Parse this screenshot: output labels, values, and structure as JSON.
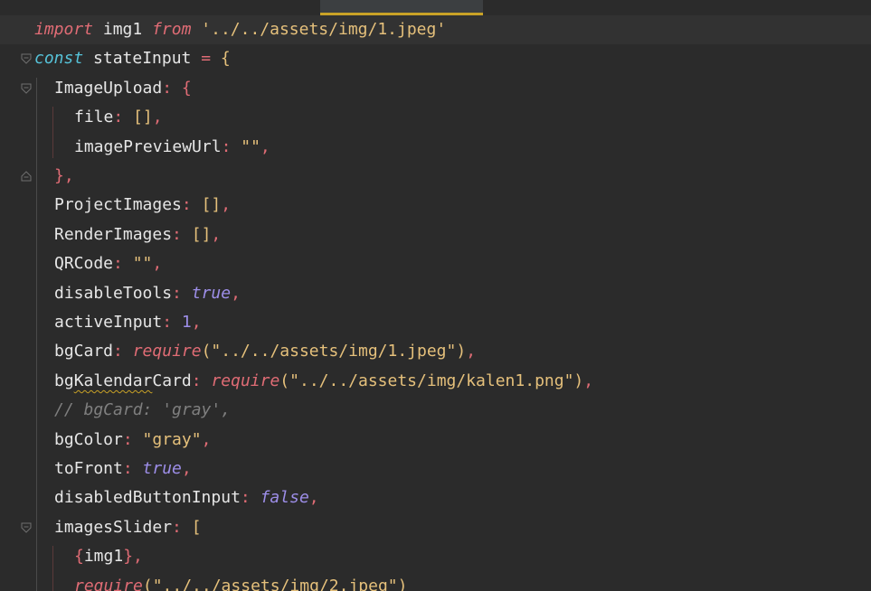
{
  "editor": {
    "lines": [
      [
        {
          "t": "import",
          "c": "kw"
        },
        {
          "t": " img1 ",
          "c": "id"
        },
        {
          "t": "from",
          "c": "kw"
        },
        {
          "t": " ",
          "c": "id"
        },
        {
          "t": "'../../assets/img/1.jpeg'",
          "c": "str"
        }
      ],
      [
        {
          "t": "const",
          "c": "const"
        },
        {
          "t": " stateInput ",
          "c": "id"
        },
        {
          "t": "=",
          "c": "punct"
        },
        {
          "t": " {",
          "c": "brace"
        }
      ],
      [
        {
          "t": "ImageUpload",
          "c": "prop"
        },
        {
          "t": ":",
          "c": "punct"
        },
        {
          "t": " {",
          "c": "punct"
        }
      ],
      [
        {
          "t": "file",
          "c": "prop"
        },
        {
          "t": ":",
          "c": "punct"
        },
        {
          "t": " []",
          "c": "brace"
        },
        {
          "t": ",",
          "c": "comma"
        }
      ],
      [
        {
          "t": "imagePreviewUrl",
          "c": "prop"
        },
        {
          "t": ":",
          "c": "punct"
        },
        {
          "t": " \"\"",
          "c": "str"
        },
        {
          "t": ",",
          "c": "comma"
        }
      ],
      [
        {
          "t": "}",
          "c": "punct"
        },
        {
          "t": ",",
          "c": "comma"
        }
      ],
      [
        {
          "t": "ProjectImages",
          "c": "prop"
        },
        {
          "t": ":",
          "c": "punct"
        },
        {
          "t": " []",
          "c": "brace"
        },
        {
          "t": ",",
          "c": "comma"
        }
      ],
      [
        {
          "t": "RenderImages",
          "c": "prop"
        },
        {
          "t": ":",
          "c": "punct"
        },
        {
          "t": " []",
          "c": "brace"
        },
        {
          "t": ",",
          "c": "comma"
        }
      ],
      [
        {
          "t": "QRCode",
          "c": "prop"
        },
        {
          "t": ":",
          "c": "punct"
        },
        {
          "t": " \"\"",
          "c": "str"
        },
        {
          "t": ",",
          "c": "comma"
        }
      ],
      [
        {
          "t": "disableTools",
          "c": "prop"
        },
        {
          "t": ":",
          "c": "punct"
        },
        {
          "t": " ",
          "c": "id"
        },
        {
          "t": "true",
          "c": "bool"
        },
        {
          "t": ",",
          "c": "comma"
        }
      ],
      [
        {
          "t": "activeInput",
          "c": "prop"
        },
        {
          "t": ":",
          "c": "punct"
        },
        {
          "t": " ",
          "c": "id"
        },
        {
          "t": "1",
          "c": "num"
        },
        {
          "t": ",",
          "c": "comma"
        }
      ],
      [
        {
          "t": "bgCard",
          "c": "prop"
        },
        {
          "t": ":",
          "c": "punct"
        },
        {
          "t": " ",
          "c": "id"
        },
        {
          "t": "require",
          "c": "fn"
        },
        {
          "t": "(",
          "c": "brace"
        },
        {
          "t": "\"../../assets/img/1.jpeg\"",
          "c": "str"
        },
        {
          "t": ")",
          "c": "brace"
        },
        {
          "t": ",",
          "c": "comma"
        }
      ],
      [
        {
          "t": "bg",
          "c": "prop"
        },
        {
          "t": "Kalendar",
          "c": "prop",
          "sq": true
        },
        {
          "t": "Card",
          "c": "prop"
        },
        {
          "t": ":",
          "c": "punct"
        },
        {
          "t": " ",
          "c": "id"
        },
        {
          "t": "require",
          "c": "fn"
        },
        {
          "t": "(",
          "c": "brace"
        },
        {
          "t": "\"../../assets/img/kalen1.png\"",
          "c": "str"
        },
        {
          "t": ")",
          "c": "brace"
        },
        {
          "t": ",",
          "c": "comma"
        }
      ],
      [
        {
          "t": "// bgCard: 'gray',",
          "c": "comment"
        }
      ],
      [
        {
          "t": "bgColor",
          "c": "prop"
        },
        {
          "t": ":",
          "c": "punct"
        },
        {
          "t": " \"gray\"",
          "c": "str"
        },
        {
          "t": ",",
          "c": "comma"
        }
      ],
      [
        {
          "t": "toFront",
          "c": "prop"
        },
        {
          "t": ":",
          "c": "punct"
        },
        {
          "t": " ",
          "c": "id"
        },
        {
          "t": "true",
          "c": "bool"
        },
        {
          "t": ",",
          "c": "comma"
        }
      ],
      [
        {
          "t": "disabledButtonInput",
          "c": "prop"
        },
        {
          "t": ":",
          "c": "punct"
        },
        {
          "t": " ",
          "c": "id"
        },
        {
          "t": "false",
          "c": "bool"
        },
        {
          "t": ",",
          "c": "comma"
        }
      ],
      [
        {
          "t": "imagesSlider",
          "c": "prop"
        },
        {
          "t": ":",
          "c": "punct"
        },
        {
          "t": " [",
          "c": "brace"
        }
      ],
      [
        {
          "t": "{",
          "c": "punct"
        },
        {
          "t": "img1",
          "c": "id"
        },
        {
          "t": "}",
          "c": "punct"
        },
        {
          "t": ",",
          "c": "comma"
        }
      ],
      [
        {
          "t": "require",
          "c": "fn"
        },
        {
          "t": "(",
          "c": "brace"
        },
        {
          "t": "\"../../assets/img/2.jpeg\"",
          "c": "str"
        },
        {
          "t": ")",
          "c": "brace"
        }
      ]
    ]
  }
}
